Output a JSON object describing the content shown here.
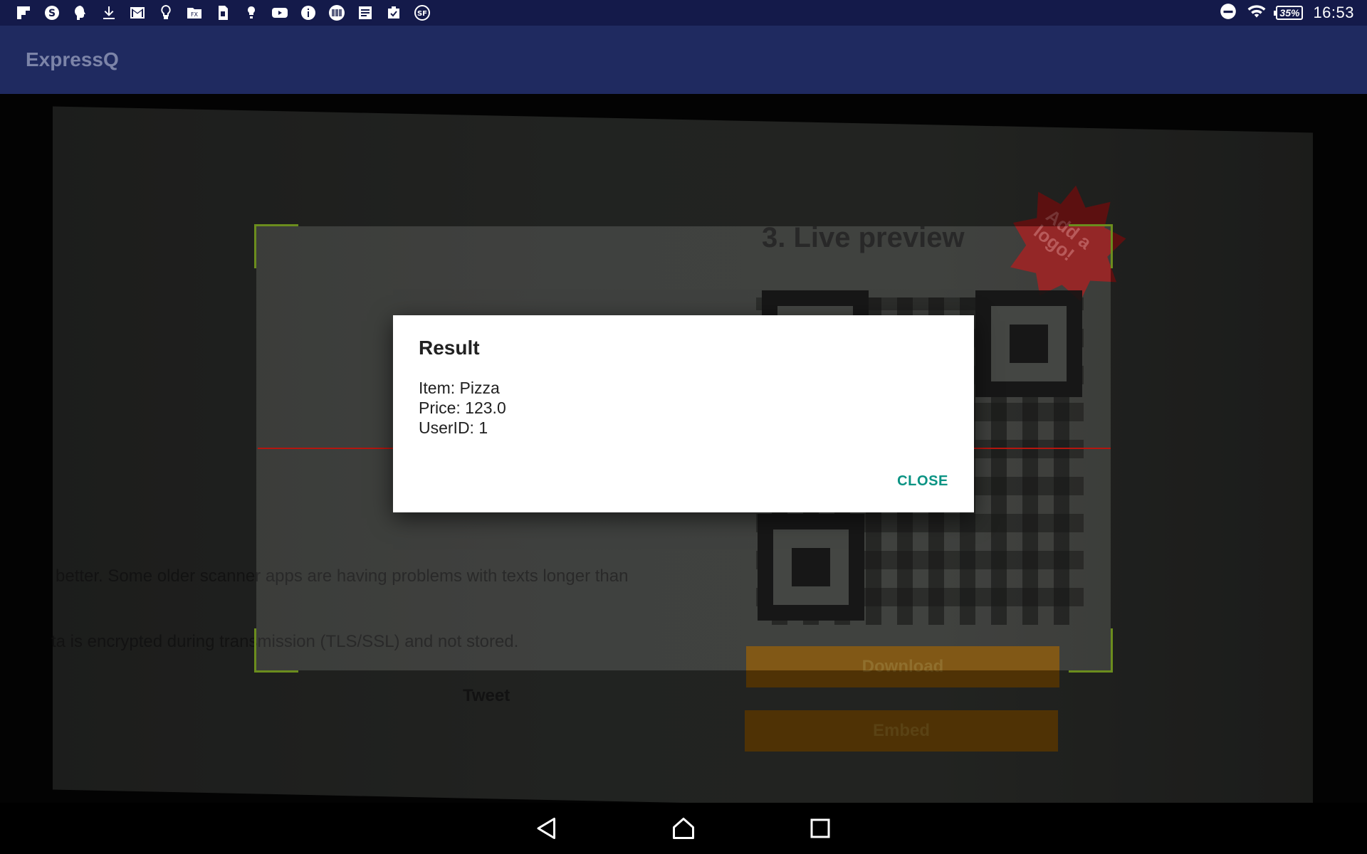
{
  "status_bar": {
    "notification_icons": [
      "flipboard-icon",
      "skype-icon",
      "brain-icon",
      "download-icon",
      "gmail-icon",
      "lightbulb-icon",
      "folder-icon",
      "sim-card-icon",
      "bulb-icon",
      "youtube-icon",
      "info-icon",
      "barcode-icon",
      "notes-icon",
      "clipboard-icon",
      "sf-icon"
    ],
    "battery_level": "35%",
    "time": "16:53"
  },
  "app_bar": {
    "title": "ExpressQ"
  },
  "camera_view": {
    "preview_title": "3. Live preview",
    "logo_badge": "Add a logo!",
    "text_line_1": "better. Some older scanner apps are having problems with texts longer than",
    "text_line_2": "ta is encrypted during transmission (TLS/SSL) and not stored.",
    "tweet_label": "Tweet",
    "download_label": "Download",
    "embed_label": "Embed"
  },
  "dialog": {
    "title": "Result",
    "lines": [
      "Item: Pizza",
      "Price: 123.0",
      "UserID: 1"
    ],
    "close_label": "CLOSE"
  },
  "colors": {
    "status_bar": "#141a4a",
    "app_bar": "#1f2a60",
    "app_title": "#7c84a8",
    "accent": "#0a9383",
    "scan_corner": "#6b8d1d",
    "laser": "#b5160f"
  }
}
